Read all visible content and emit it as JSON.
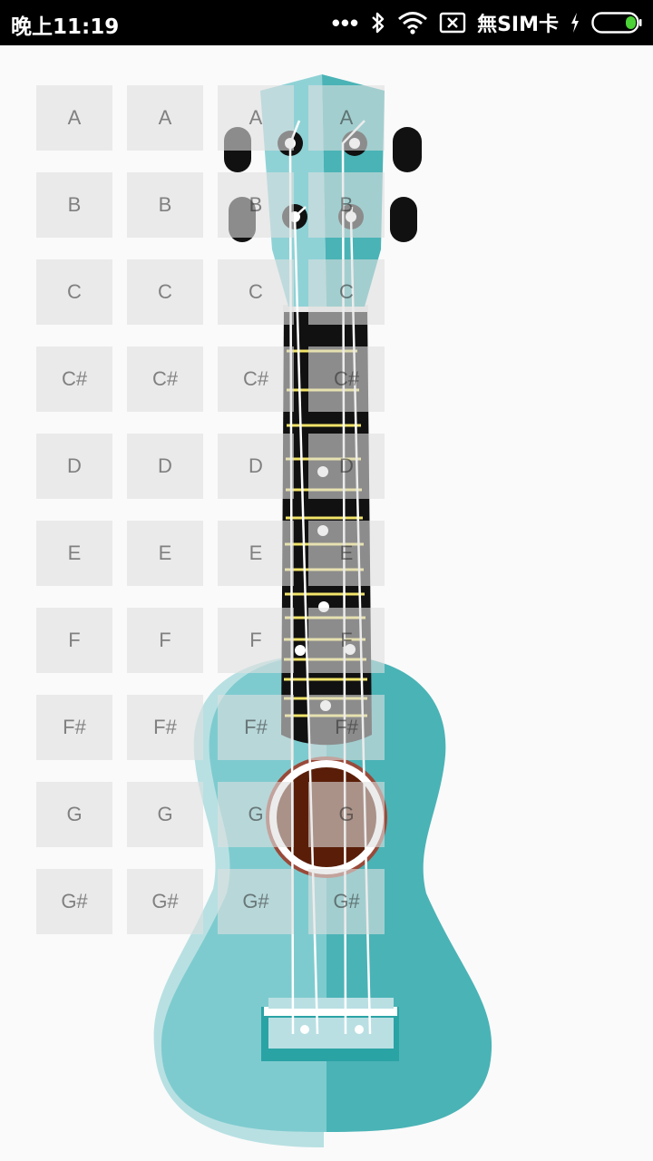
{
  "status_bar": {
    "time": "晚上11:19",
    "more": "•••",
    "carrier": "無SIM卡",
    "icons": [
      "bluetooth-icon",
      "wifi-icon",
      "sim-error-icon",
      "charging-icon",
      "battery-icon"
    ],
    "battery_color": "#4cd137"
  },
  "instrument": {
    "name": "ukulele",
    "colors": {
      "body_light": "#7ecbcf",
      "body_dark": "#4ab3b6",
      "fretboard": "#111111",
      "frets": "#f1e46a",
      "soundhole": "#5a1e08",
      "rosette": "#9a4a3a"
    }
  },
  "note_grid": {
    "strings": [
      {
        "notes": [
          "A",
          "B",
          "C",
          "C#",
          "D",
          "E",
          "F",
          "F#",
          "G",
          "G#"
        ]
      },
      {
        "notes": [
          "A",
          "B",
          "C",
          "C#",
          "D",
          "E",
          "F",
          "F#",
          "G",
          "G#"
        ]
      },
      {
        "notes": [
          "A",
          "B",
          "C",
          "C#",
          "D",
          "E",
          "F",
          "F#",
          "G",
          "G#"
        ]
      },
      {
        "notes": [
          "A",
          "B",
          "C",
          "C#",
          "D",
          "E",
          "F",
          "F#",
          "G",
          "G#"
        ]
      }
    ]
  }
}
